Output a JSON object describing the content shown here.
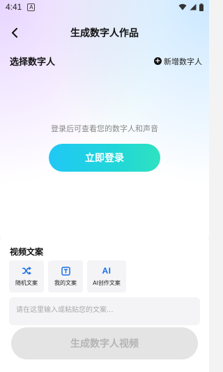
{
  "status_bar": {
    "time": "4:41",
    "notification": "A"
  },
  "header": {
    "title": "生成数字人作品"
  },
  "avatar_section": {
    "title": "选择数字人",
    "add_label": "新增数字人"
  },
  "login": {
    "hint": "登录后可查看您的数字人和声音",
    "button_label": "立即登录"
  },
  "script_panel": {
    "title": "视频文案",
    "options": [
      {
        "label": "随机文案",
        "icon": "shuffle-icon"
      },
      {
        "label": "我的文案",
        "icon": "text-doc-icon"
      },
      {
        "label": "AI创作文案",
        "icon": "ai-sparkle-icon",
        "icon_text": "AI"
      }
    ],
    "input_placeholder": "请在这里输入或粘贴您的文案..."
  },
  "footer": {
    "generate_label": "生成数字人视频"
  },
  "colors": {
    "login_gradient_start": "#20c8f5",
    "login_gradient_end": "#2ee2c0",
    "ai_blue": "#1a6fe8"
  }
}
